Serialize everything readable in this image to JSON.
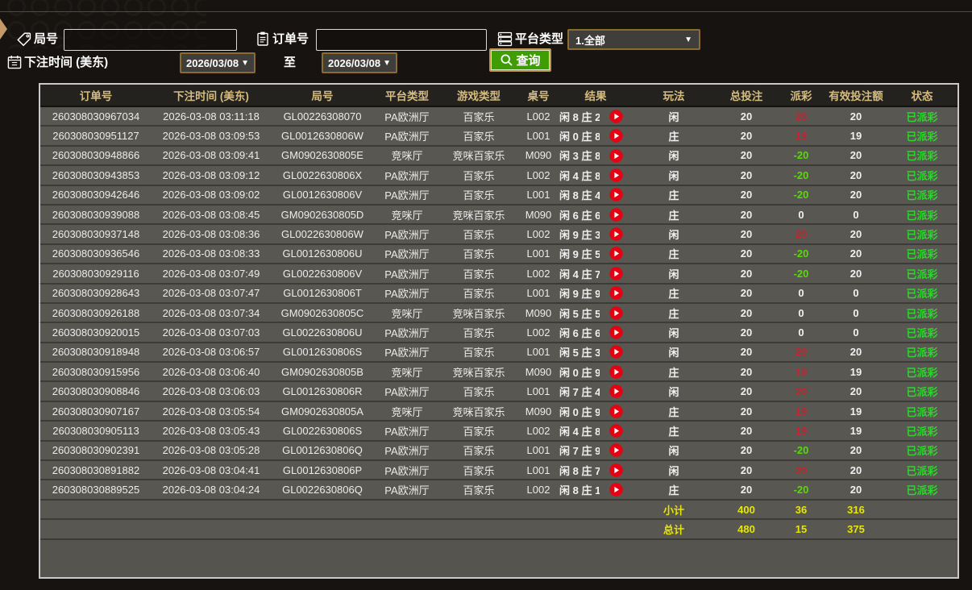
{
  "filters": {
    "round_no": {
      "label": "局号",
      "value": ""
    },
    "order_no": {
      "label": "订单号",
      "value": ""
    },
    "platform_type": {
      "label": "平台类型",
      "selected": "1.全部"
    },
    "bet_time": {
      "label": "下注时间 (美东)",
      "from": "2026/03/08",
      "to_label": "至",
      "to": "2026/03/08"
    },
    "query_button_label": "查询"
  },
  "icons": {
    "round_no": "tag-icon",
    "order_no": "clipboard-icon",
    "platform_type": "server-list-icon",
    "bet_time": "calendar-icon",
    "query": "search-icon",
    "video_column": "play-icon",
    "dropdowns": "chevron-down-icon"
  },
  "colors": {
    "page_bg": "#161310",
    "row_bg": "#595752",
    "header_bg": "#24221e",
    "header_text_gold": "#d5bb80",
    "payout_positive_red": "#c3242e",
    "payout_negative_green": "#54dc04",
    "status_green": "#2fd42f",
    "summary_yellow": "#e6e600",
    "button_green": "#3f9c02",
    "dropdown_border_brown": "#8d6b30",
    "play_icon_red": "#e50012",
    "side_arrow_tan": "#c49a66"
  },
  "table": {
    "headers": [
      {
        "key": "order",
        "label": "订单号"
      },
      {
        "key": "time",
        "label": "下注时间 (美东)"
      },
      {
        "key": "round",
        "label": "局号"
      },
      {
        "key": "platform",
        "label": "平台类型"
      },
      {
        "key": "game",
        "label": "游戏类型"
      },
      {
        "key": "table-no",
        "label": "桌号"
      },
      {
        "key": "result",
        "label": "结果",
        "colspan": 2
      },
      {
        "key": "play",
        "label": "玩法"
      },
      {
        "key": "total-bet",
        "label": "总投注"
      },
      {
        "key": "payout",
        "label": "派彩"
      },
      {
        "key": "valid-bet",
        "label": "有效投注额"
      },
      {
        "key": "status",
        "label": "状态"
      }
    ],
    "column_keys": [
      "order",
      "time",
      "round",
      "platform",
      "game",
      "table_no",
      "result",
      "video",
      "play",
      "total_bet",
      "payout",
      "valid_bet",
      "status"
    ],
    "rows": [
      {
        "order": "260308030967034",
        "time": "2026-03-08 03:11:18",
        "round": "GL00226308070",
        "platform": "PA欧洲厅",
        "game": "百家乐",
        "table_no": "L002",
        "result": "闲 8 庄 2",
        "play": "闲",
        "total_bet": 20,
        "payout": 20,
        "valid_bet": 20,
        "status": "已派彩"
      },
      {
        "order": "260308030951127",
        "time": "2026-03-08 03:09:53",
        "round": "GL0012630806W",
        "platform": "PA欧洲厅",
        "game": "百家乐",
        "table_no": "L001",
        "result": "闲 0 庄 8",
        "play": "庄",
        "total_bet": 20,
        "payout": 19,
        "valid_bet": 19,
        "status": "已派彩"
      },
      {
        "order": "260308030948866",
        "time": "2026-03-08 03:09:41",
        "round": "GM0902630805E",
        "platform": "竞咪厅",
        "game": "竞咪百家乐",
        "table_no": "M090",
        "result": "闲 3 庄 8",
        "play": "闲",
        "total_bet": 20,
        "payout": -20,
        "valid_bet": 20,
        "status": "已派彩"
      },
      {
        "order": "260308030943853",
        "time": "2026-03-08 03:09:12",
        "round": "GL0022630806X",
        "platform": "PA欧洲厅",
        "game": "百家乐",
        "table_no": "L002",
        "result": "闲 4 庄 8",
        "play": "闲",
        "total_bet": 20,
        "payout": -20,
        "valid_bet": 20,
        "status": "已派彩"
      },
      {
        "order": "260308030942646",
        "time": "2026-03-08 03:09:02",
        "round": "GL0012630806V",
        "platform": "PA欧洲厅",
        "game": "百家乐",
        "table_no": "L001",
        "result": "闲 8 庄 4",
        "play": "庄",
        "total_bet": 20,
        "payout": -20,
        "valid_bet": 20,
        "status": "已派彩"
      },
      {
        "order": "260308030939088",
        "time": "2026-03-08 03:08:45",
        "round": "GM0902630805D",
        "platform": "竞咪厅",
        "game": "竞咪百家乐",
        "table_no": "M090",
        "result": "闲 6 庄 6",
        "play": "庄",
        "total_bet": 20,
        "payout": 0,
        "valid_bet": 0,
        "status": "已派彩"
      },
      {
        "order": "260308030937148",
        "time": "2026-03-08 03:08:36",
        "round": "GL0022630806W",
        "platform": "PA欧洲厅",
        "game": "百家乐",
        "table_no": "L002",
        "result": "闲 9 庄 3",
        "play": "闲",
        "total_bet": 20,
        "payout": 20,
        "valid_bet": 20,
        "status": "已派彩"
      },
      {
        "order": "260308030936546",
        "time": "2026-03-08 03:08:33",
        "round": "GL0012630806U",
        "platform": "PA欧洲厅",
        "game": "百家乐",
        "table_no": "L001",
        "result": "闲 9 庄 5",
        "play": "庄",
        "total_bet": 20,
        "payout": -20,
        "valid_bet": 20,
        "status": "已派彩"
      },
      {
        "order": "260308030929116",
        "time": "2026-03-08 03:07:49",
        "round": "GL0022630806V",
        "platform": "PA欧洲厅",
        "game": "百家乐",
        "table_no": "L002",
        "result": "闲 4 庄 7",
        "play": "闲",
        "total_bet": 20,
        "payout": -20,
        "valid_bet": 20,
        "status": "已派彩"
      },
      {
        "order": "260308030928643",
        "time": "2026-03-08 03:07:47",
        "round": "GL0012630806T",
        "platform": "PA欧洲厅",
        "game": "百家乐",
        "table_no": "L001",
        "result": "闲 9 庄 9",
        "play": "庄",
        "total_bet": 20,
        "payout": 0,
        "valid_bet": 0,
        "status": "已派彩"
      },
      {
        "order": "260308030926188",
        "time": "2026-03-08 03:07:34",
        "round": "GM0902630805C",
        "platform": "竞咪厅",
        "game": "竞咪百家乐",
        "table_no": "M090",
        "result": "闲 5 庄 5",
        "play": "庄",
        "total_bet": 20,
        "payout": 0,
        "valid_bet": 0,
        "status": "已派彩"
      },
      {
        "order": "260308030920015",
        "time": "2026-03-08 03:07:03",
        "round": "GL0022630806U",
        "platform": "PA欧洲厅",
        "game": "百家乐",
        "table_no": "L002",
        "result": "闲 6 庄 6",
        "play": "闲",
        "total_bet": 20,
        "payout": 0,
        "valid_bet": 0,
        "status": "已派彩"
      },
      {
        "order": "260308030918948",
        "time": "2026-03-08 03:06:57",
        "round": "GL0012630806S",
        "platform": "PA欧洲厅",
        "game": "百家乐",
        "table_no": "L001",
        "result": "闲 5 庄 3",
        "play": "闲",
        "total_bet": 20,
        "payout": 20,
        "valid_bet": 20,
        "status": "已派彩"
      },
      {
        "order": "260308030915956",
        "time": "2026-03-08 03:06:40",
        "round": "GM0902630805B",
        "platform": "竞咪厅",
        "game": "竞咪百家乐",
        "table_no": "M090",
        "result": "闲 0 庄 9",
        "play": "庄",
        "total_bet": 20,
        "payout": 19,
        "valid_bet": 19,
        "status": "已派彩"
      },
      {
        "order": "260308030908846",
        "time": "2026-03-08 03:06:03",
        "round": "GL0012630806R",
        "platform": "PA欧洲厅",
        "game": "百家乐",
        "table_no": "L001",
        "result": "闲 7 庄 4",
        "play": "闲",
        "total_bet": 20,
        "payout": 20,
        "valid_bet": 20,
        "status": "已派彩"
      },
      {
        "order": "260308030907167",
        "time": "2026-03-08 03:05:54",
        "round": "GM0902630805A",
        "platform": "竞咪厅",
        "game": "竞咪百家乐",
        "table_no": "M090",
        "result": "闲 0 庄 9",
        "play": "庄",
        "total_bet": 20,
        "payout": 19,
        "valid_bet": 19,
        "status": "已派彩"
      },
      {
        "order": "260308030905113",
        "time": "2026-03-08 03:05:43",
        "round": "GL0022630806S",
        "platform": "PA欧洲厅",
        "game": "百家乐",
        "table_no": "L002",
        "result": "闲 4 庄 8",
        "play": "庄",
        "total_bet": 20,
        "payout": 19,
        "valid_bet": 19,
        "status": "已派彩"
      },
      {
        "order": "260308030902391",
        "time": "2026-03-08 03:05:28",
        "round": "GL0012630806Q",
        "platform": "PA欧洲厅",
        "game": "百家乐",
        "table_no": "L001",
        "result": "闲 7 庄 9",
        "play": "闲",
        "total_bet": 20,
        "payout": -20,
        "valid_bet": 20,
        "status": "已派彩"
      },
      {
        "order": "260308030891882",
        "time": "2026-03-08 03:04:41",
        "round": "GL0012630806P",
        "platform": "PA欧洲厅",
        "game": "百家乐",
        "table_no": "L001",
        "result": "闲 8 庄 7",
        "play": "闲",
        "total_bet": 20,
        "payout": 20,
        "valid_bet": 20,
        "status": "已派彩"
      },
      {
        "order": "260308030889525",
        "time": "2026-03-08 03:04:24",
        "round": "GL0022630806Q",
        "platform": "PA欧洲厅",
        "game": "百家乐",
        "table_no": "L002",
        "result": "闲 8 庄 1",
        "play": "庄",
        "total_bet": 20,
        "payout": -20,
        "valid_bet": 20,
        "status": "已派彩"
      }
    ],
    "summary": [
      {
        "label": "小计",
        "total_bet": 400,
        "payout": 36,
        "valid_bet": 316
      },
      {
        "label": "总计",
        "total_bet": 480,
        "payout": 15,
        "valid_bet": 375
      }
    ]
  }
}
